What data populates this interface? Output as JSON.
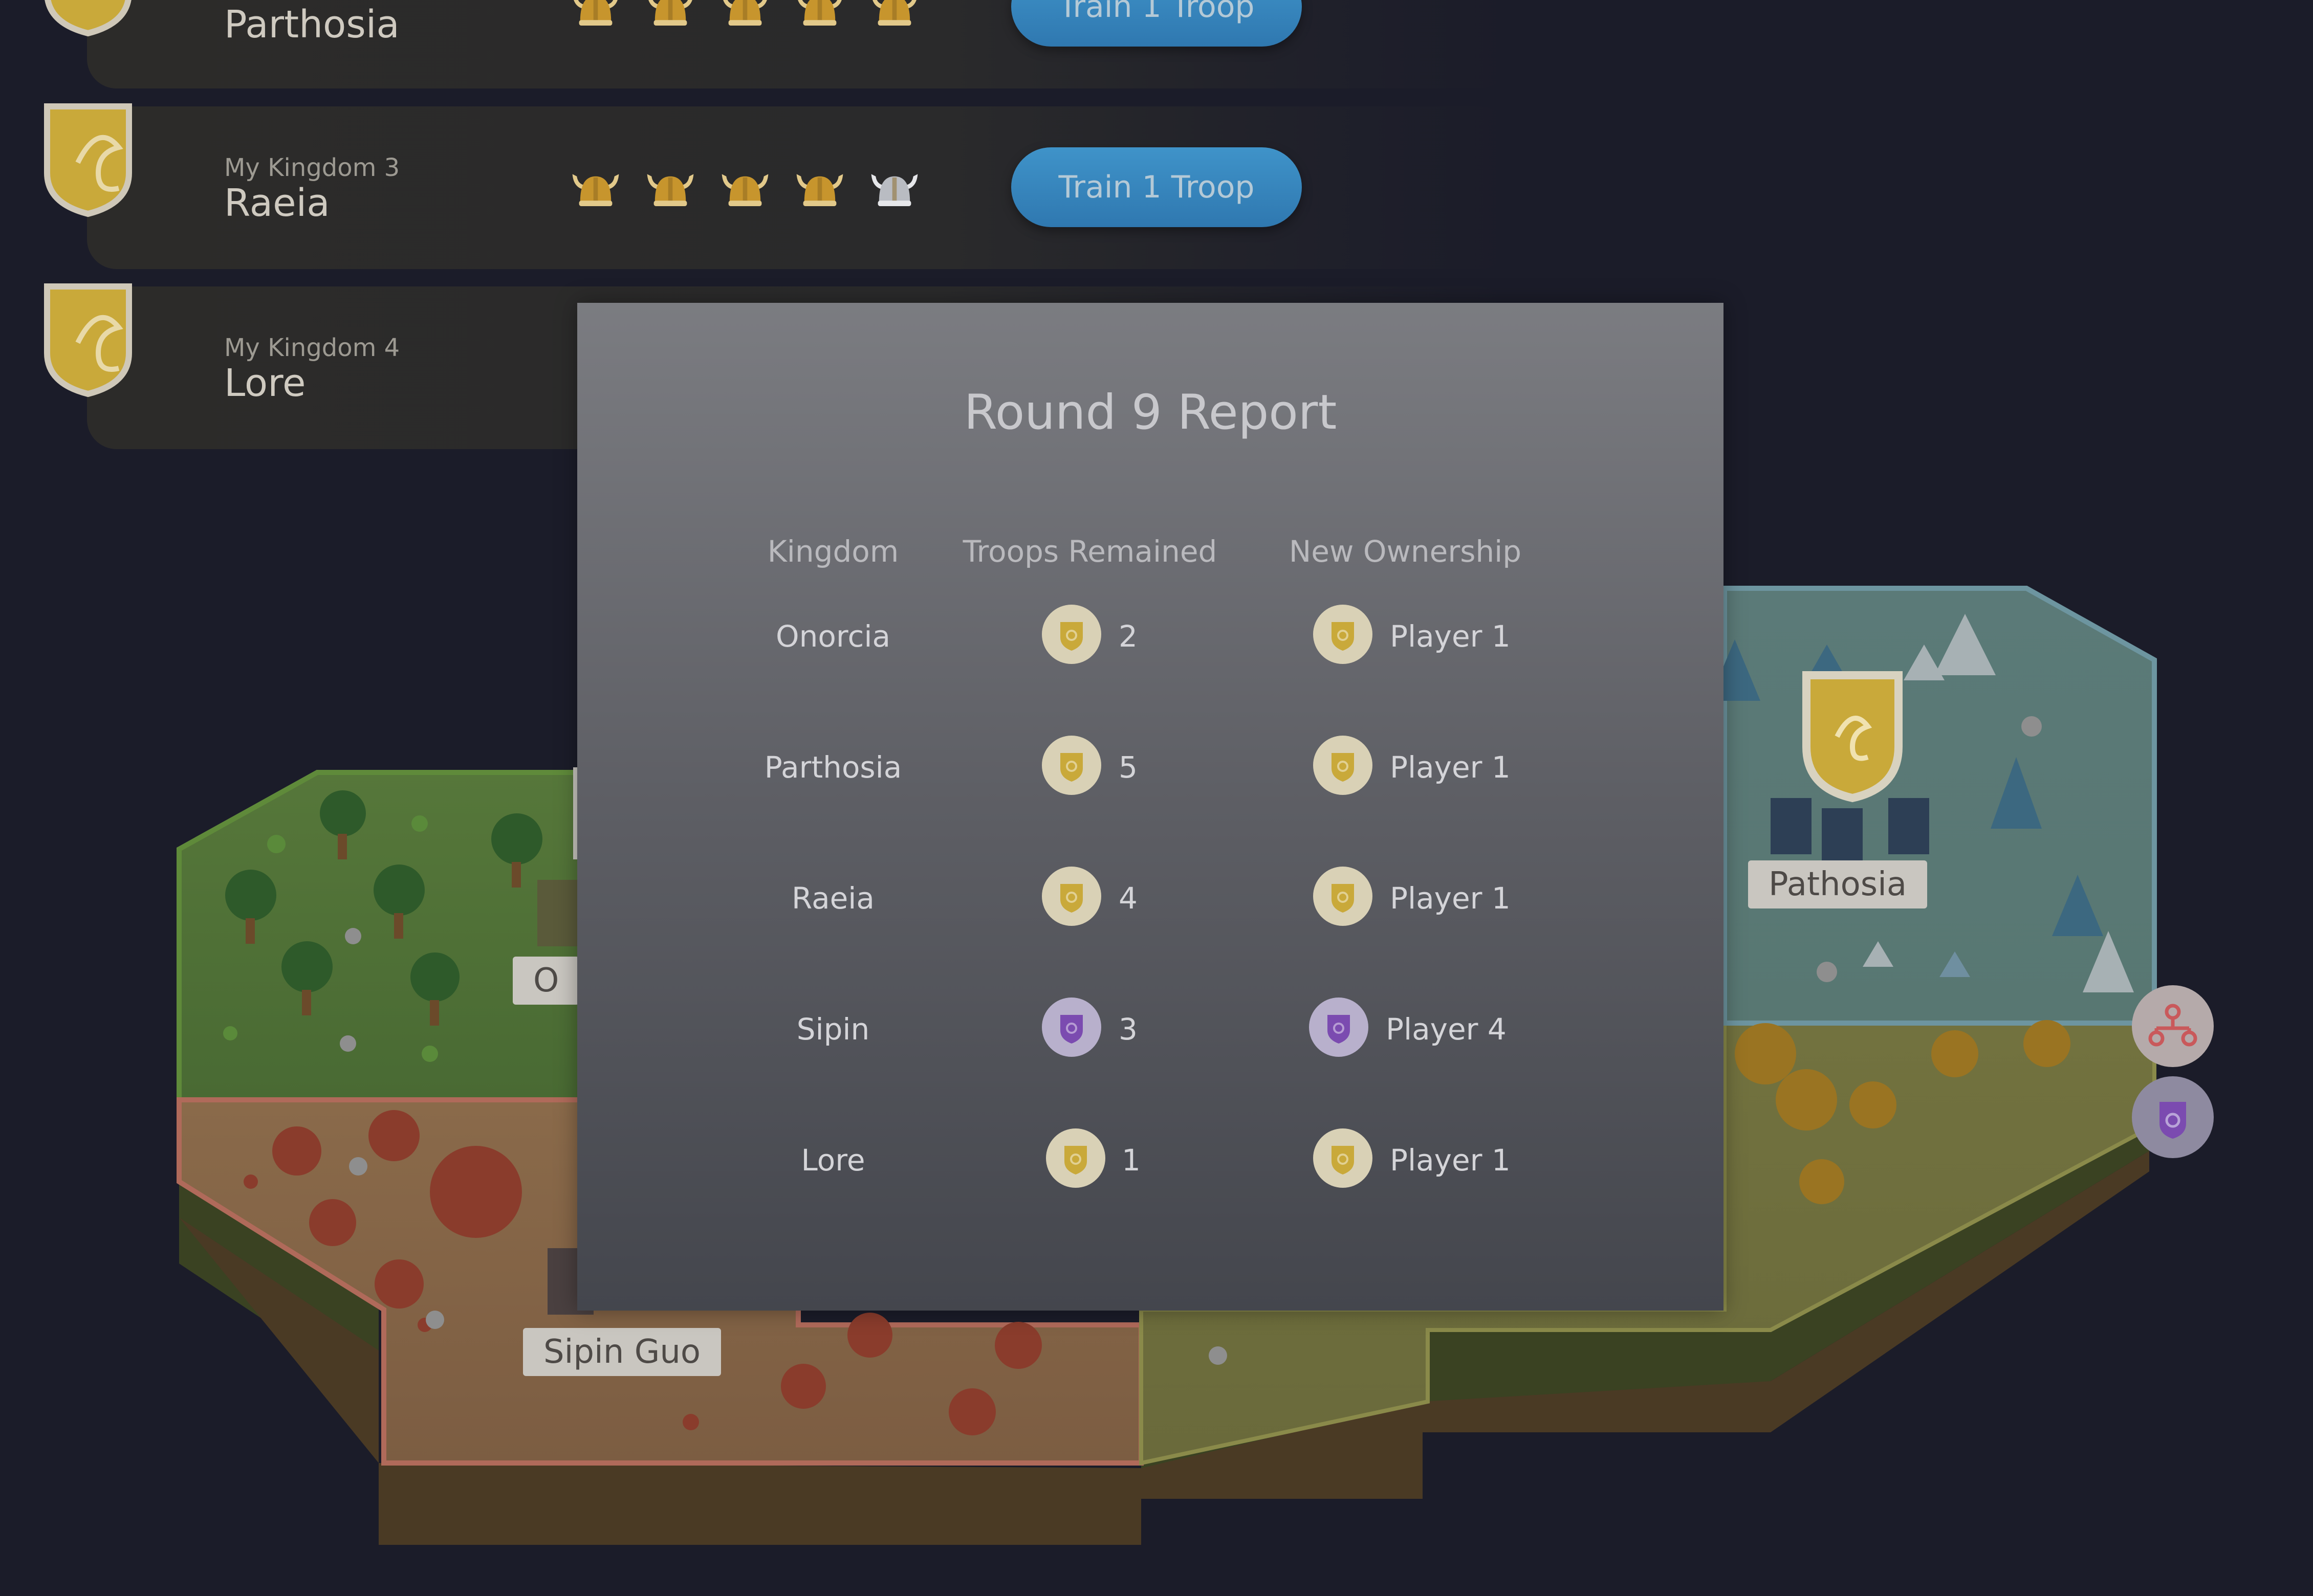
{
  "kingdoms_list": [
    {
      "sub": "",
      "name": "Parthosia",
      "helmets": [
        "gold",
        "gold",
        "gold",
        "gold",
        "gold"
      ],
      "button": "Train 1 Troop"
    },
    {
      "sub": "My Kingdom 3",
      "name": "Raeia",
      "helmets": [
        "gold",
        "gold",
        "gold",
        "gold",
        "silver"
      ],
      "button": "Train 1 Troop"
    },
    {
      "sub": "My Kingdom 4",
      "name": "Lore",
      "helmets": [],
      "button": ""
    }
  ],
  "map": {
    "labels": {
      "onorcia_partial": "O",
      "sipin_guo": "Sipin Guo",
      "pathosia": "Pathosia"
    },
    "side_buttons": [
      {
        "icon": "network-icon",
        "color": "#c9595b"
      },
      {
        "icon": "purple-shield-icon",
        "color": "#7b4bb0"
      }
    ]
  },
  "report": {
    "title": "Round 9 Report",
    "headers": {
      "kingdom": "Kingdom",
      "troops": "Troops Remained",
      "ownership": "New Ownership"
    },
    "rows": [
      {
        "kingdom": "Onorcia",
        "troops": "2",
        "owner": "Player 1",
        "faction": "gold"
      },
      {
        "kingdom": "Parthosia",
        "troops": "5",
        "owner": "Player 1",
        "faction": "gold"
      },
      {
        "kingdom": "Raeia",
        "troops": "4",
        "owner": "Player 1",
        "faction": "gold"
      },
      {
        "kingdom": "Sipin",
        "troops": "3",
        "owner": "Player 4",
        "faction": "purple"
      },
      {
        "kingdom": "Lore",
        "troops": "1",
        "owner": "Player 1",
        "faction": "gold"
      }
    ]
  },
  "colors": {
    "gold": "#c9a93a",
    "purple": "#7b4bb0",
    "button_blue": "#3a88c0",
    "background": "#1b1c29"
  }
}
